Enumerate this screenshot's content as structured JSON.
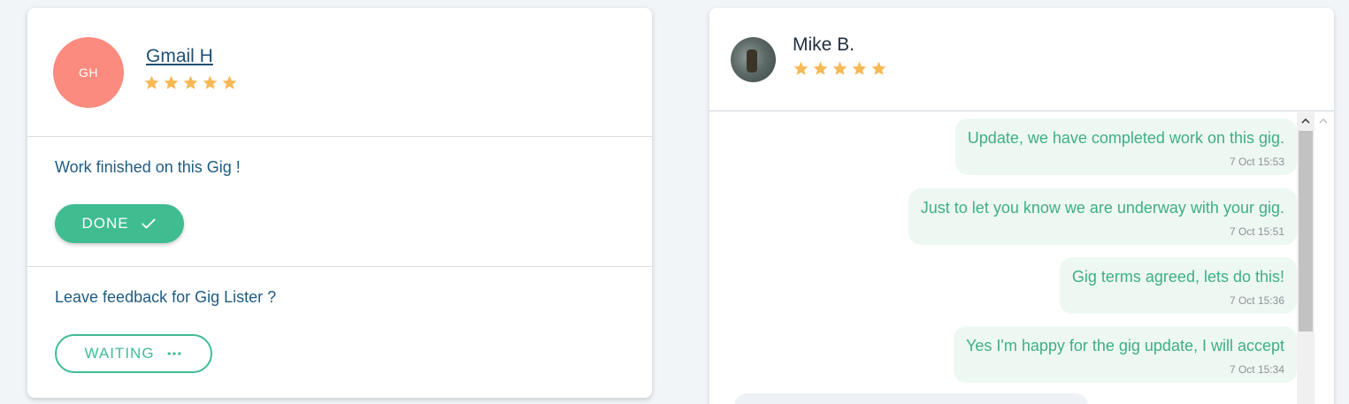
{
  "left": {
    "initials": "GH",
    "name": "Gmail H",
    "rating_stars": 5,
    "work_status_text": "Work finished on this Gig !",
    "done_label": "DONE",
    "feedback_text": "Leave feedback for Gig Lister ?",
    "waiting_label": "WAITING"
  },
  "chat": {
    "name": "Mike B.",
    "rating_stars": 5,
    "messages": [
      {
        "text": "Update, we have completed work on this gig.",
        "time": "7 Oct 15:53"
      },
      {
        "text": "Just to let you know we are underway with your gig.",
        "time": "7 Oct 15:51"
      },
      {
        "text": "Gig terms agreed, lets do this!",
        "time": "7 Oct 15:36"
      },
      {
        "text": "Yes I'm happy for the gig update, I will accept",
        "time": "7 Oct 15:34"
      }
    ]
  },
  "colors": {
    "accent": "#40bc91",
    "star": "#f7b955",
    "avatar_bg": "#fb8b7e",
    "link": "#1e4f74"
  },
  "icons": {
    "done": "check-icon",
    "waiting": "more-horizontal-icon",
    "rating": "star-icon"
  }
}
